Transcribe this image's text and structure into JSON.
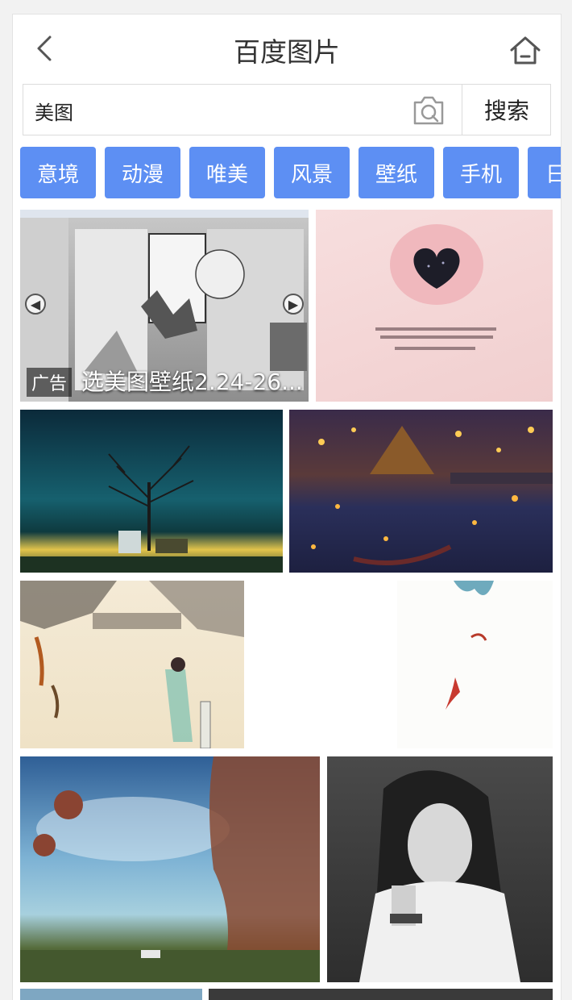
{
  "header": {
    "title": "百度图片"
  },
  "search": {
    "value": "美图",
    "button_label": "搜索"
  },
  "tags": [
    {
      "label": "意境"
    },
    {
      "label": "动漫"
    },
    {
      "label": "唯美"
    },
    {
      "label": "风景"
    },
    {
      "label": "壁纸"
    },
    {
      "label": "手机"
    },
    {
      "label": "日"
    }
  ],
  "ad": {
    "badge": "广告",
    "title": "选美图壁纸2.24-26..."
  },
  "colors": {
    "accent": "#5d8ff3",
    "title_text": "#333333"
  },
  "icons": {
    "back": "chevron-left-icon",
    "home": "home-icon",
    "camera": "camera-search-icon"
  }
}
